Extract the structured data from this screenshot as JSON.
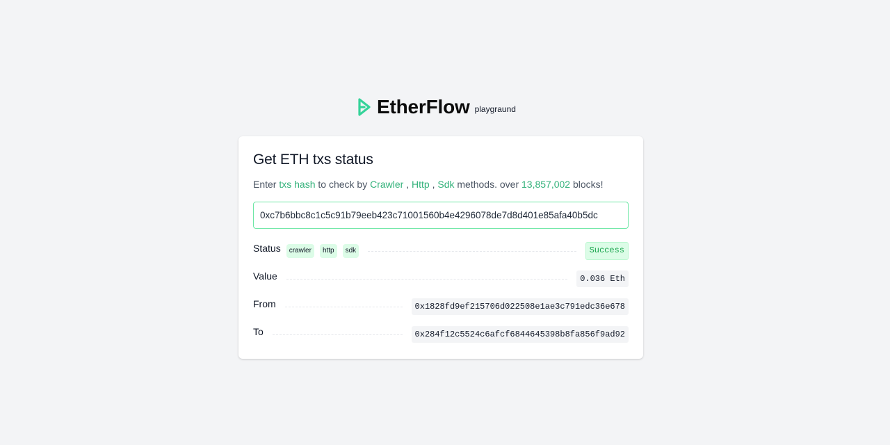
{
  "header": {
    "brand_name": "EtherFlow",
    "brand_sub": "playgraund"
  },
  "card": {
    "title": "Get ETH txs status",
    "desc": {
      "enter": "Enter",
      "txs_hash": "txs hash",
      "to_check_by": "to check by",
      "crawler": "Crawler",
      "sep1": ",",
      "http": "Http",
      "sep2": ",",
      "sdk": "Sdk",
      "methods_over": "methods. over",
      "block_count": "13,857,002",
      "blocks": "blocks!"
    },
    "hash_value": "0xc7b6bbc8c1c5c91b79eeb423c71001560b4e4296078de7d8d401e85afa40b5dc"
  },
  "details": {
    "status": {
      "label": "Status",
      "methods": [
        "crawler",
        "http",
        "sdk"
      ],
      "value": "Success"
    },
    "value": {
      "label": "Value",
      "value": "0.036 Eth"
    },
    "from": {
      "label": "From",
      "value": "0x1828fd9ef215706d022508e1ae3c791edc36e678"
    },
    "to": {
      "label": "To",
      "value": "0x284f12c5524c6afcf6844645398b8fa856f9ad92"
    }
  },
  "colors": {
    "accent": "#34b27b",
    "logo": "#34d399",
    "success_bg": "#dcfce7",
    "success_text": "#16a34a",
    "page_bg": "#f3f4f6"
  },
  "icons": {
    "logo": "etherflow-logo-icon"
  }
}
